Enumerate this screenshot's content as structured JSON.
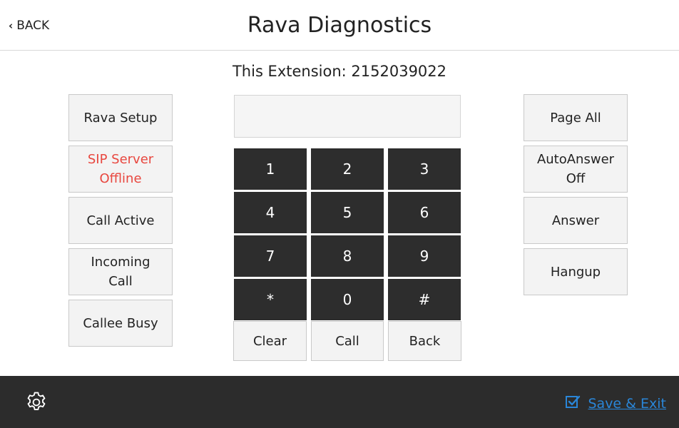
{
  "header": {
    "back_label": "BACK",
    "title": "Rava Diagnostics"
  },
  "extension_label": "This Extension: 2152039022",
  "left_buttons": [
    {
      "label": "Rava Setup",
      "state": "normal"
    },
    {
      "label": "SIP Server\nOffline",
      "state": "alert",
      "color": "#e8473f"
    },
    {
      "label": "Call Active",
      "state": "normal"
    },
    {
      "label": "Incoming\nCall",
      "state": "normal"
    },
    {
      "label": "Callee Busy",
      "state": "normal"
    }
  ],
  "dialer": {
    "display_value": "",
    "keys": [
      "1",
      "2",
      "3",
      "4",
      "5",
      "6",
      "7",
      "8",
      "9",
      "*",
      "0",
      "#"
    ],
    "actions": [
      "Clear",
      "Call",
      "Back"
    ]
  },
  "right_buttons": [
    {
      "label": "Page All"
    },
    {
      "label": "AutoAnswer\nOff"
    },
    {
      "label": "Answer"
    },
    {
      "label": "Hangup"
    }
  ],
  "footer": {
    "settings_icon": "gear-icon",
    "save_label": "Save & Exit",
    "save_icon": "checkbox-checked-icon",
    "accent_color": "#2a86d8"
  },
  "colors": {
    "footer_bg": "#2c2c2c",
    "keypad_bg": "#2d2d2d"
  }
}
